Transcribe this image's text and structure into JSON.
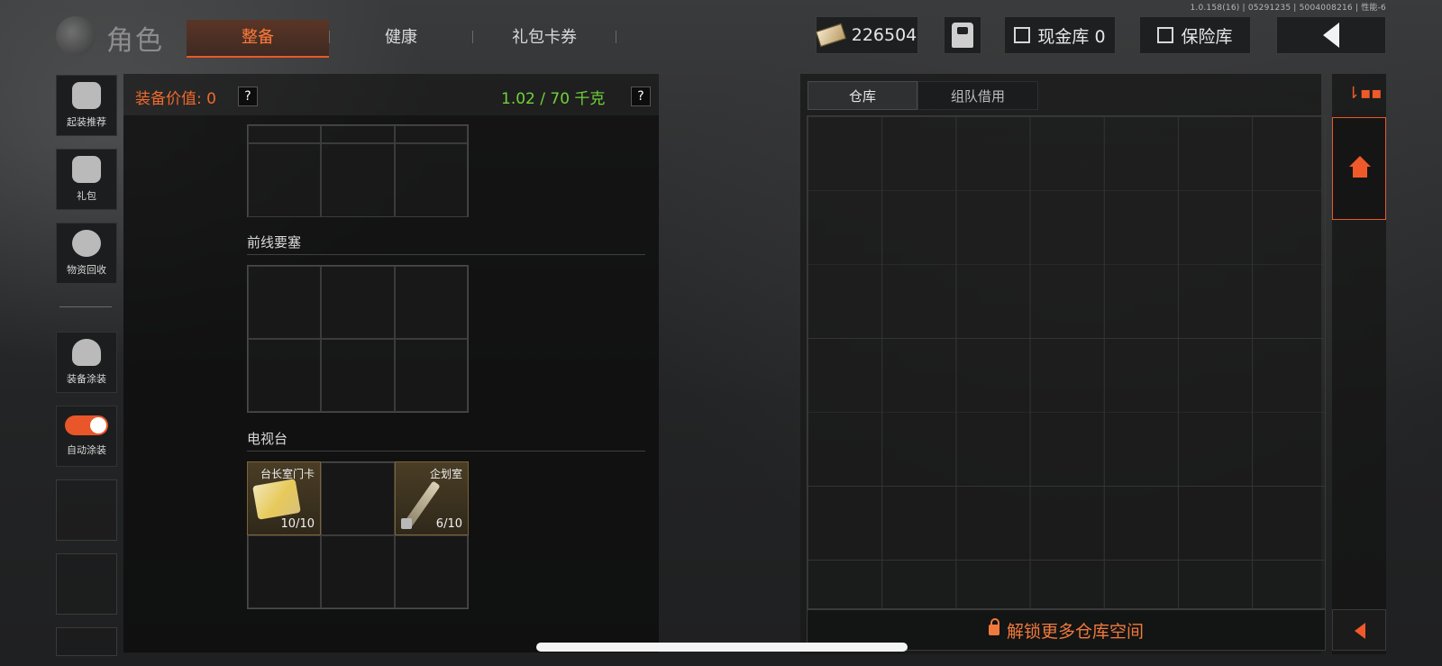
{
  "version_text": "1.0.158(16) | 05291235 | 5004008216 | 性能-6",
  "header": {
    "title": "角色",
    "tabs": [
      {
        "label": "整备",
        "active": true
      },
      {
        "label": "健康",
        "active": false
      },
      {
        "label": "礼包卡券",
        "active": false
      }
    ],
    "currency": "226504",
    "cash_vault": "现金库 0",
    "safe_vault": "保险库"
  },
  "sidebar": {
    "items": [
      {
        "label": "起装推荐",
        "icon": "helmet-gun-icon"
      },
      {
        "label": "礼包",
        "icon": "gift-icon"
      },
      {
        "label": "物资回收",
        "icon": "recycle-icon"
      },
      {
        "label": "装备涂装",
        "icon": "soldier-icon"
      },
      {
        "label": "自动涂装",
        "icon": "toggle-icon"
      }
    ]
  },
  "equipment": {
    "value_label": "装备价值: 0",
    "weight_label": "1.02 / 70 千克",
    "help": "?",
    "sections": [
      {
        "title": "前线要塞"
      },
      {
        "title": "电视台"
      }
    ],
    "items": [
      {
        "name": "台长室门卡",
        "count": "10/10",
        "icon": "keycard-icon"
      },
      {
        "name": "企划室",
        "count": "6/10",
        "icon": "key-icon"
      }
    ]
  },
  "storage": {
    "tabs": [
      {
        "label": "仓库",
        "active": true
      },
      {
        "label": "组队借用",
        "active": false
      }
    ],
    "unlock_label": "解锁更多仓库空间"
  },
  "colors": {
    "accent": "#e85a25",
    "weight": "#6fd23a"
  }
}
